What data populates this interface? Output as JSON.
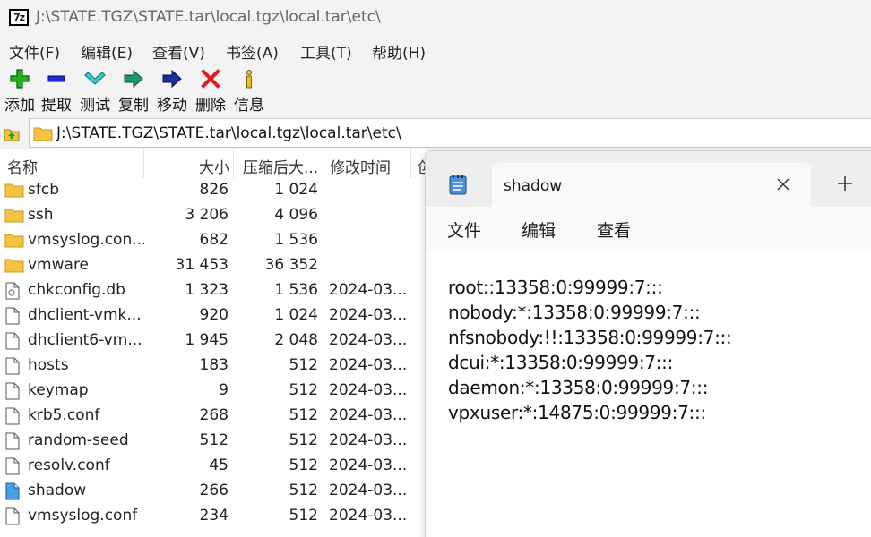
{
  "sevenzip": {
    "title": "J:\\STATE.TGZ\\STATE.tar\\local.tgz\\local.tar\\etc\\",
    "app_icon_text": "7z",
    "menu": [
      "文件(F)",
      "编辑(E)",
      "查看(V)",
      "书签(A)",
      "工具(T)",
      "帮助(H)"
    ],
    "toolbar": [
      {
        "label": "添加",
        "icon": "add-icon"
      },
      {
        "label": "提取",
        "icon": "extract-icon"
      },
      {
        "label": "测试",
        "icon": "test-icon"
      },
      {
        "label": "复制",
        "icon": "copy-icon"
      },
      {
        "label": "移动",
        "icon": "move-icon"
      },
      {
        "label": "删除",
        "icon": "delete-icon"
      },
      {
        "label": "信息",
        "icon": "info-icon"
      }
    ],
    "address": "J:\\STATE.TGZ\\STATE.tar\\local.tgz\\local.tar\\etc\\",
    "columns": {
      "name": "名称",
      "size": "大小",
      "packed": "压缩后大...",
      "modified": "修改时间",
      "created": "创"
    },
    "files": [
      {
        "name": "sfcb",
        "size": "826",
        "packed": "1 024",
        "modified": "",
        "type": "folder"
      },
      {
        "name": "ssh",
        "size": "3 206",
        "packed": "4 096",
        "modified": "",
        "type": "folder"
      },
      {
        "name": "vmsyslog.con...",
        "size": "682",
        "packed": "1 536",
        "modified": "",
        "type": "folder"
      },
      {
        "name": "vmware",
        "size": "31 453",
        "packed": "36 352",
        "modified": "",
        "type": "folder"
      },
      {
        "name": "chkconfig.db",
        "size": "1 323",
        "packed": "1 536",
        "modified": "2024-03...",
        "type": "db"
      },
      {
        "name": "dhclient-vmk...",
        "size": "920",
        "packed": "1 024",
        "modified": "2024-03...",
        "type": "file"
      },
      {
        "name": "dhclient6-vm...",
        "size": "1 945",
        "packed": "2 048",
        "modified": "2024-03...",
        "type": "file"
      },
      {
        "name": "hosts",
        "size": "183",
        "packed": "512",
        "modified": "2024-03...",
        "type": "file"
      },
      {
        "name": "keymap",
        "size": "9",
        "packed": "512",
        "modified": "2024-03...",
        "type": "file"
      },
      {
        "name": "krb5.conf",
        "size": "268",
        "packed": "512",
        "modified": "2024-03...",
        "type": "file"
      },
      {
        "name": "random-seed",
        "size": "512",
        "packed": "512",
        "modified": "2024-03...",
        "type": "file"
      },
      {
        "name": "resolv.conf",
        "size": "45",
        "packed": "512",
        "modified": "2024-03...",
        "type": "file"
      },
      {
        "name": "shadow",
        "size": "266",
        "packed": "512",
        "modified": "2024-03...",
        "type": "selected"
      },
      {
        "name": "vmsyslog.conf",
        "size": "234",
        "packed": "512",
        "modified": "2024-03...",
        "type": "file"
      }
    ]
  },
  "notepad": {
    "tab_title": "shadow",
    "menu": [
      "文件",
      "编辑",
      "查看"
    ],
    "lines": [
      "root::13358:0:99999:7:::",
      "nobody:*:13358:0:99999:7:::",
      "nfsnobody:!!:13358:0:99999:7:::",
      "dcui:*:13358:0:99999:7:::",
      "daemon:*:13358:0:99999:7:::",
      "vpxuser:*:14875:0:99999:7:::"
    ]
  },
  "colors": {
    "folder": "#f5c342",
    "selected_file": "#4aa0e6",
    "chrome": "#f3f3f3"
  }
}
